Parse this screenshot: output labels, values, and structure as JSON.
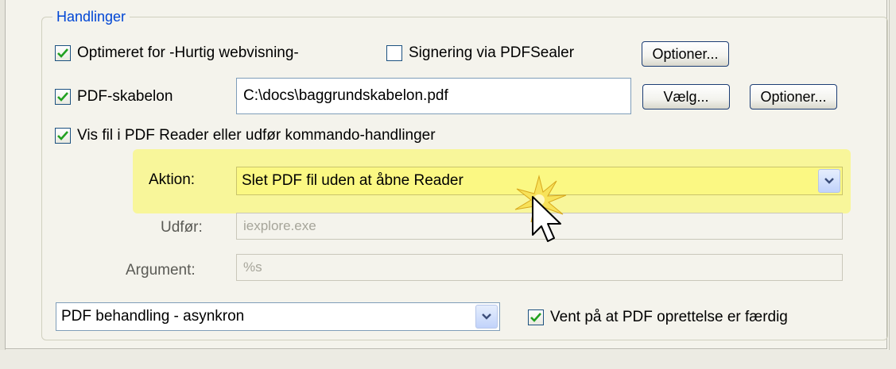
{
  "group": {
    "title": "Handlinger"
  },
  "optimize": {
    "label": "Optimeret for -Hurtig webvisning-",
    "checked": true
  },
  "signing": {
    "label": "Signering via PDFSealer",
    "checked": false,
    "options_button": "Optioner..."
  },
  "template": {
    "label": "PDF-skabelon",
    "checked": true,
    "path": "C:\\docs\\baggrundskabelon.pdf",
    "choose_button": "Vælg...",
    "options_button": "Optioner..."
  },
  "show_file": {
    "label": "Vis fil i PDF Reader eller udfør kommando-handlinger",
    "checked": true
  },
  "action": {
    "label": "Aktion:",
    "value": "Slet PDF fil uden at åbne Reader"
  },
  "execute": {
    "label": "Udfør:",
    "value": "iexplore.exe"
  },
  "argument": {
    "label": "Argument:",
    "value": "%s"
  },
  "processing": {
    "value": "PDF behandling - asynkron"
  },
  "wait": {
    "label": "Vent på at PDF oprettelse er færdig",
    "checked": true
  },
  "colors": {
    "accent": "#0046d5",
    "highlight": "#f8f69a",
    "check": "#21a121"
  },
  "icons": {
    "checkmark": "checkmark-icon",
    "dropdown": "chevron-down-icon",
    "cursor": "mouse-pointer-icon"
  }
}
